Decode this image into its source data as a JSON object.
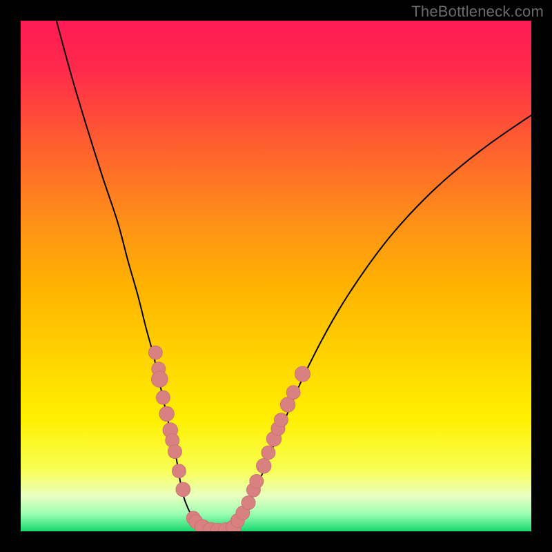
{
  "watermark": "TheBottleneck.com",
  "palette": {
    "frame": "#000000",
    "gradient_stops": [
      {
        "offset": 0.0,
        "color": "#ff1a55"
      },
      {
        "offset": 0.1,
        "color": "#ff2b4a"
      },
      {
        "offset": 0.22,
        "color": "#ff5733"
      },
      {
        "offset": 0.38,
        "color": "#ff8c1a"
      },
      {
        "offset": 0.52,
        "color": "#ffb300"
      },
      {
        "offset": 0.66,
        "color": "#ffd400"
      },
      {
        "offset": 0.78,
        "color": "#fff000"
      },
      {
        "offset": 0.88,
        "color": "#f8ff55"
      },
      {
        "offset": 0.93,
        "color": "#eaffc0"
      },
      {
        "offset": 0.965,
        "color": "#9fffb3"
      },
      {
        "offset": 1.0,
        "color": "#19d86f"
      }
    ],
    "curve_stroke": "#000000",
    "marker_fill": "#d98080",
    "marker_stroke": "#c96f6f"
  },
  "chart_data": {
    "type": "line",
    "title": "",
    "xlabel": "",
    "ylabel": "",
    "xlim": [
      0,
      100
    ],
    "ylim": [
      0,
      100
    ],
    "series": [
      {
        "name": "left-limb",
        "x": [
          7,
          10,
          13,
          16,
          19,
          21,
          23,
          24.5,
          26,
          27,
          28,
          29,
          30,
          30.7,
          31.3,
          32,
          33,
          34,
          35,
          36
        ],
        "y": [
          100,
          89,
          79,
          69.5,
          60.5,
          53,
          46,
          40,
          34.5,
          30,
          25.5,
          21,
          17,
          13,
          9.5,
          6.5,
          4,
          2.2,
          1,
          0.4
        ]
      },
      {
        "name": "trough",
        "x": [
          36,
          37,
          38,
          39,
          40,
          41
        ],
        "y": [
          0.4,
          0.15,
          0.1,
          0.1,
          0.15,
          0.4
        ]
      },
      {
        "name": "right-limb",
        "x": [
          41,
          42,
          43.5,
          45,
          47,
          49,
          52,
          55,
          59,
          63,
          68,
          73,
          79,
          85,
          92,
          100
        ],
        "y": [
          0.4,
          1.4,
          3.2,
          6,
          10.5,
          15.5,
          22.5,
          29.5,
          37.5,
          44.5,
          52,
          58.5,
          65,
          70.5,
          76,
          81.5
        ]
      }
    ],
    "markers": [
      {
        "x": 26.4,
        "y": 35.0,
        "r": 1.35
      },
      {
        "x": 27.0,
        "y": 31.8,
        "r": 1.35
      },
      {
        "x": 27.2,
        "y": 29.8,
        "r": 1.6
      },
      {
        "x": 27.9,
        "y": 26.2,
        "r": 1.35
      },
      {
        "x": 28.6,
        "y": 23.0,
        "r": 1.45
      },
      {
        "x": 29.3,
        "y": 19.8,
        "r": 1.45
      },
      {
        "x": 29.7,
        "y": 17.8,
        "r": 1.35
      },
      {
        "x": 30.2,
        "y": 15.6,
        "r": 1.35
      },
      {
        "x": 31.0,
        "y": 11.8,
        "r": 1.35
      },
      {
        "x": 31.8,
        "y": 8.2,
        "r": 1.4
      },
      {
        "x": 33.8,
        "y": 2.6,
        "r": 1.35
      },
      {
        "x": 34.3,
        "y": 1.9,
        "r": 1.35
      },
      {
        "x": 35.6,
        "y": 0.8,
        "r": 1.5
      },
      {
        "x": 37.2,
        "y": 0.25,
        "r": 1.5
      },
      {
        "x": 38.6,
        "y": 0.1,
        "r": 1.5
      },
      {
        "x": 40.2,
        "y": 0.2,
        "r": 1.5
      },
      {
        "x": 41.7,
        "y": 0.75,
        "r": 1.5
      },
      {
        "x": 42.5,
        "y": 2.1,
        "r": 1.35
      },
      {
        "x": 43.5,
        "y": 3.6,
        "r": 1.35
      },
      {
        "x": 44.6,
        "y": 5.6,
        "r": 1.35
      },
      {
        "x": 45.6,
        "y": 8.1,
        "r": 1.35
      },
      {
        "x": 46.2,
        "y": 9.8,
        "r": 1.35
      },
      {
        "x": 47.6,
        "y": 12.8,
        "r": 1.45
      },
      {
        "x": 48.5,
        "y": 15.4,
        "r": 1.35
      },
      {
        "x": 49.6,
        "y": 18.1,
        "r": 1.45
      },
      {
        "x": 50.4,
        "y": 20.1,
        "r": 1.35
      },
      {
        "x": 51.0,
        "y": 21.8,
        "r": 1.35
      },
      {
        "x": 52.3,
        "y": 24.8,
        "r": 1.45
      },
      {
        "x": 53.4,
        "y": 27.2,
        "r": 1.35
      },
      {
        "x": 55.2,
        "y": 30.8,
        "r": 1.5
      }
    ]
  }
}
